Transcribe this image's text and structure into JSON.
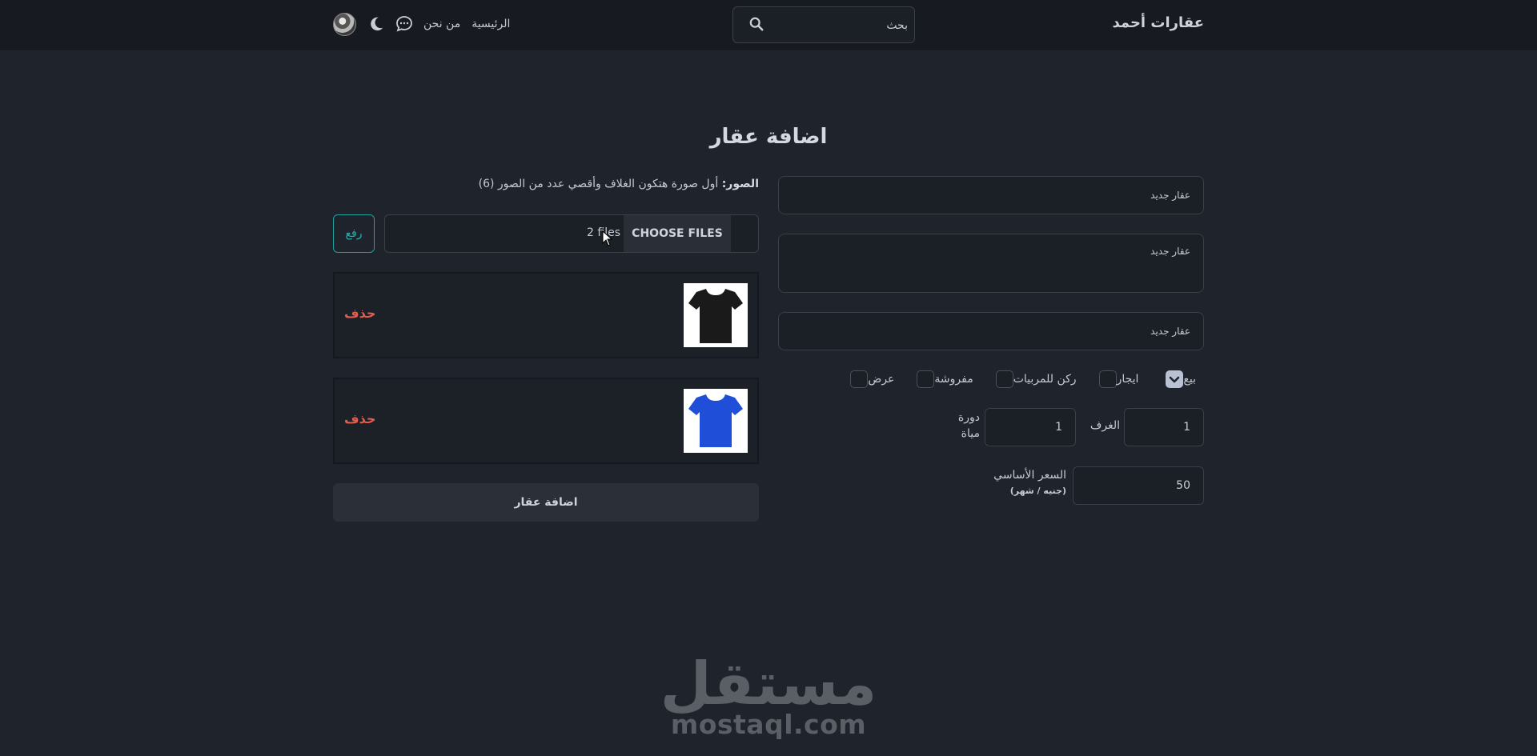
{
  "navbar": {
    "brand": "عقارات أحمد",
    "search_placeholder": "بحث",
    "links": [
      "الرئيسية",
      "من نحن"
    ]
  },
  "page": {
    "title": "اضافة عقار"
  },
  "form": {
    "title_value": "عقار جديد",
    "description_value": "عقار جديد",
    "address_value": "عقار جديد",
    "checkboxes": [
      {
        "label": "بيع",
        "checked": true
      },
      {
        "label": "ايجار",
        "checked": false
      },
      {
        "label": "ركن للمربيات",
        "checked": false
      },
      {
        "label": "مفروشة",
        "checked": false
      },
      {
        "label": "عرض",
        "checked": false
      }
    ],
    "rooms_label": "الغرف",
    "rooms_value": "1",
    "bathrooms_label": "دورة مياة",
    "bathrooms_value": "1",
    "price_label": "السعر الأساسي",
    "price_unit": "(جنيه / شهر)",
    "price_value": "50"
  },
  "images": {
    "note_bold": "الصور:",
    "note_text": " أول صورة هتكون الغلاف وأقصي عدد من الصور (6)",
    "choose_label": "CHOOSE FILES",
    "file_count": "2 files",
    "upload_label": "رفع",
    "items": [
      {
        "delete_label": "حذف",
        "thumb": "black-tshirt"
      },
      {
        "delete_label": "حذف",
        "thumb": "blue-tshirt"
      }
    ],
    "colors": {
      "black_tshirt": "#1a1a1a",
      "blue_tshirt": "#1f4ed8"
    }
  },
  "submit_label": "اضافة عقار",
  "watermark": {
    "arabic": "مستقل",
    "latin": "mostaql.com"
  },
  "colors": {
    "background": "#1f232b",
    "navbar": "#171a20",
    "accent_teal": "#1fb5b2",
    "delete_red": "#e35d4e"
  }
}
